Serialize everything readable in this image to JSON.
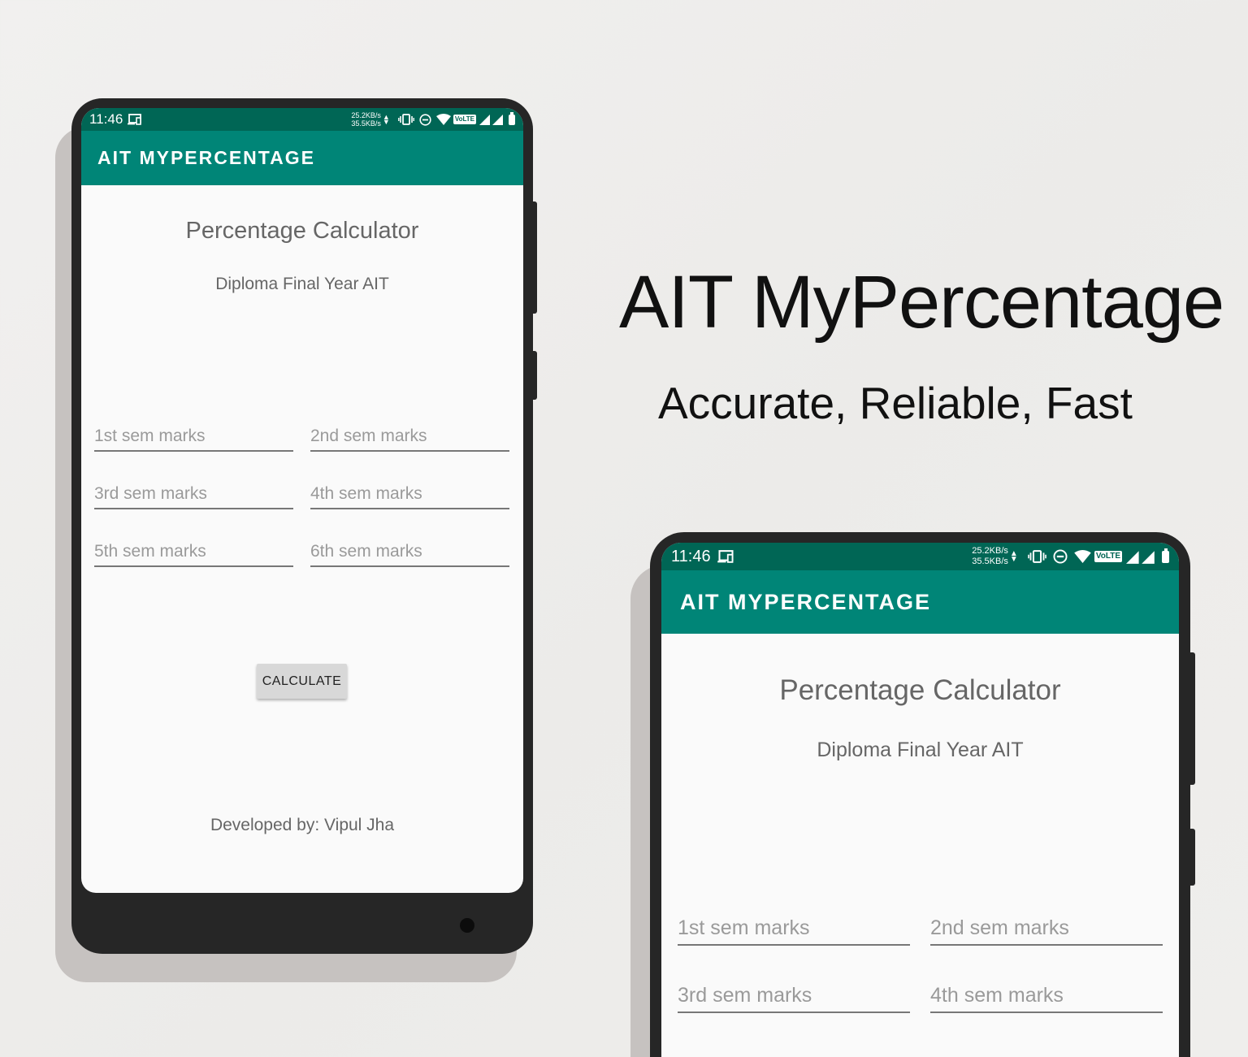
{
  "hero": {
    "title": "AIT MyPercentage",
    "subtitle": "Accurate, Reliable, Fast"
  },
  "status_bar": {
    "time": "11:46",
    "net_up": "25.2KB/s",
    "net_down": "35.5KB/s",
    "volte_label": "VoLTE",
    "cast_icon": "cast-icon",
    "vibrate_icon": "vibrate-icon",
    "dnd_icon": "do-not-disturb-icon",
    "wifi_icon": "wifi-icon",
    "signal_icon": "signal-icon",
    "battery_icon": "battery-icon"
  },
  "app": {
    "app_bar_title": "AIT MYPERCENTAGE",
    "calc_title": "Percentage Calculator",
    "calc_subtitle": "Diploma Final Year AIT",
    "fields": [
      {
        "placeholder": "1st sem marks"
      },
      {
        "placeholder": "2nd sem marks"
      },
      {
        "placeholder": "3rd sem marks"
      },
      {
        "placeholder": "4th sem marks"
      },
      {
        "placeholder": "5th sem marks"
      },
      {
        "placeholder": "6th sem marks"
      }
    ],
    "calculate_label": "CALCULATE",
    "developer_text": "Developed by: Vipul Jha"
  },
  "colors": {
    "status_bar": "#006655",
    "app_bar": "#008577",
    "screen_bg": "#fafafa",
    "phone_body": "#262626"
  }
}
